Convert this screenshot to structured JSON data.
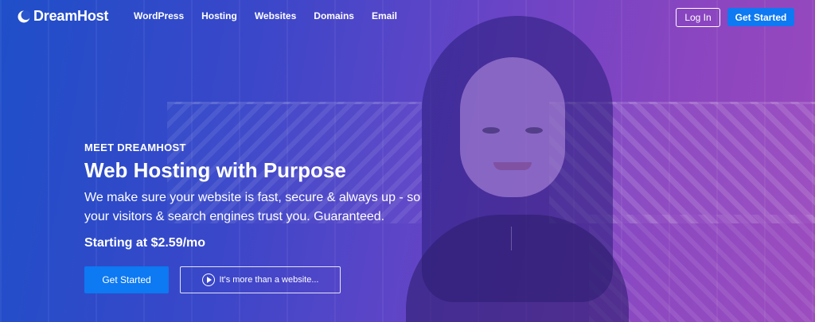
{
  "brand": {
    "name": "DreamHost",
    "logo_icon": "crescent-moon-icon"
  },
  "nav": {
    "items": [
      "WordPress",
      "Hosting",
      "Websites",
      "Domains",
      "Email"
    ],
    "login_label": "Log In",
    "get_started_label": "Get Started"
  },
  "hero": {
    "eyebrow": "MEET DREAMHOST",
    "headline": "Web Hosting with Purpose",
    "description": "We make sure your website is fast, secure & always up - so your visitors & search engines trust you. Guaranteed.",
    "price": "Starting at $2.59/mo",
    "cta_label": "Get Started",
    "video_label": "It's more than a website...",
    "video_icon": "play-circle-icon"
  },
  "colors": {
    "accent": "#0d79f2",
    "gradient_start": "#1f4fc9",
    "gradient_end": "#9a49bd"
  }
}
